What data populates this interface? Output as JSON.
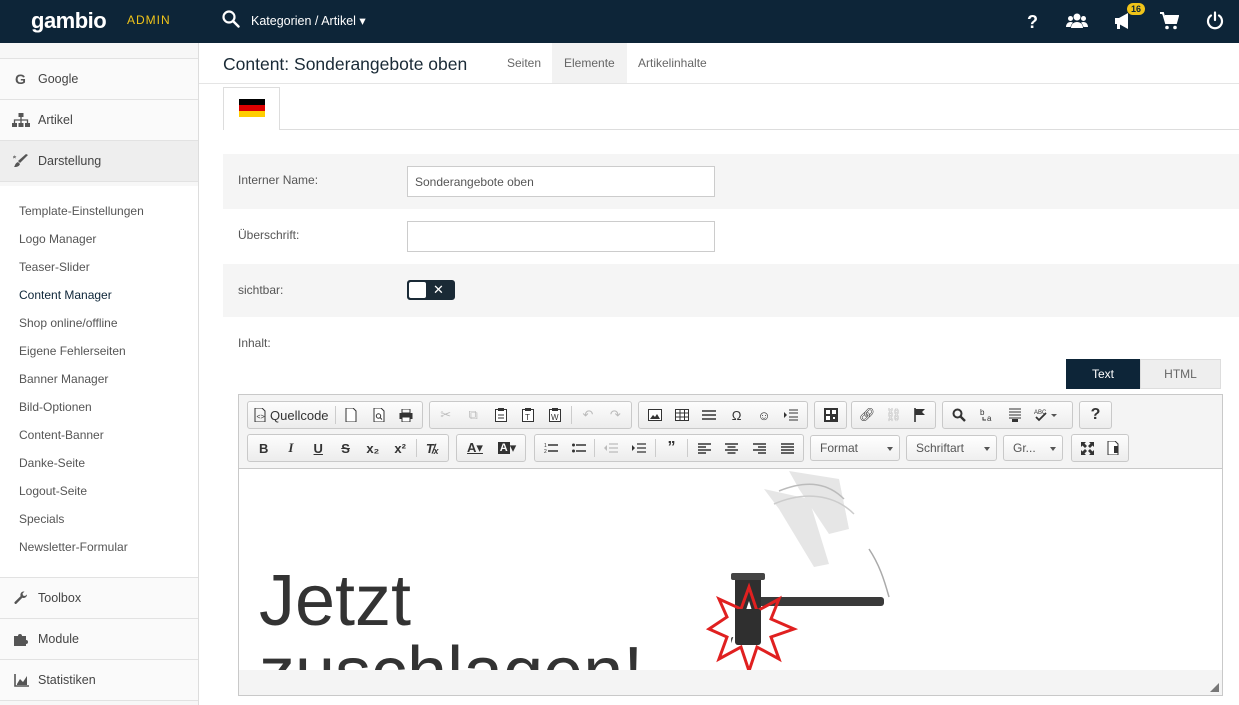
{
  "topbar": {
    "logo": "gambio",
    "admin_label": "ADMIN",
    "breadcrumb": "Kategorien / Artikel ▾",
    "notification_count": "16",
    "bg_color": "#0d2538",
    "accent_color": "#f0c419"
  },
  "sidebar": {
    "top_items": [
      {
        "label": "Google",
        "icon": "google-icon"
      },
      {
        "label": "Artikel",
        "icon": "sitemap-icon"
      },
      {
        "label": "Darstellung",
        "icon": "paint-brush-icon"
      }
    ],
    "sub_items": [
      "Template-Einstellungen",
      "Logo Manager",
      "Teaser-Slider",
      "Content Manager",
      "Shop online/offline",
      "Eigene Fehlerseiten",
      "Banner Manager",
      "Bild-Optionen",
      "Content-Banner",
      "Danke-Seite",
      "Logout-Seite",
      "Specials",
      "Newsletter-Formular"
    ],
    "bottom_items": [
      {
        "label": "Toolbox",
        "icon": "wrench-icon"
      },
      {
        "label": "Module",
        "icon": "puzzle-icon"
      },
      {
        "label": "Statistiken",
        "icon": "chart-icon"
      }
    ]
  },
  "header": {
    "title": "Content: Sonderangebote oben",
    "tabs": [
      "Seiten",
      "Elemente",
      "Artikelinhalte"
    ],
    "active_tab": "Elemente"
  },
  "form": {
    "internal_name_label": "Interner Name:",
    "internal_name_value": "Sonderangebote oben",
    "heading_label": "Überschrift:",
    "heading_value": "",
    "visible_label": "sichtbar:",
    "visible_state": false,
    "content_label": "Inhalt:",
    "mode_text": "Text",
    "mode_html": "HTML"
  },
  "editor": {
    "source_label": "Quellcode",
    "format_label": "Format",
    "font_label": "Schriftart",
    "size_label": "Gr...",
    "body_text_line1": "Jetzt",
    "body_text_line2": "zuschlagen!"
  }
}
